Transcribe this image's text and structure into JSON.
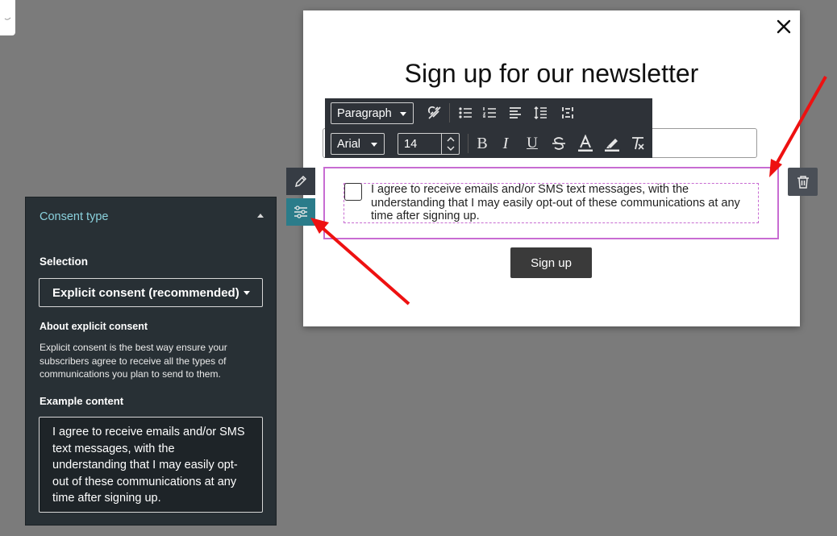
{
  "popup": {
    "title": "Sign up for our newsletter",
    "consent_text": "I agree to receive emails and/or SMS text messages, with the understanding that I may easily opt-out of these communications at any time after signing up.",
    "signup_label": "Sign up"
  },
  "toolbar": {
    "block_type": "Paragraph",
    "font_family": "Arial",
    "font_size": "14",
    "icons": [
      "unlink-icon",
      "bulleted-list-icon",
      "numbered-list-icon",
      "align-left-icon",
      "line-height-icon",
      "merge-tags-icon",
      "bold-icon",
      "italic-icon",
      "underline-icon",
      "strikethrough-icon",
      "text-color-icon",
      "highlight-icon",
      "clear-format-icon"
    ]
  },
  "panel": {
    "section_title": "Consent type",
    "selection_label": "Selection",
    "selection_value": "Explicit consent (recommended)",
    "about_label": "About explicit consent",
    "about_text": "Explicit consent is the best way ensure your subscribers agree to receive all the types of communications you plan to send to them.",
    "example_label": "Example content",
    "example_text": "I agree to receive emails and/or SMS text messages, with the understanding that I may easily opt-out of these communications at any time after signing up."
  },
  "colors": {
    "accent_teal": "#2b7c8a",
    "selection_border": "#c86cd2",
    "annotation_arrow": "#ee1111"
  }
}
